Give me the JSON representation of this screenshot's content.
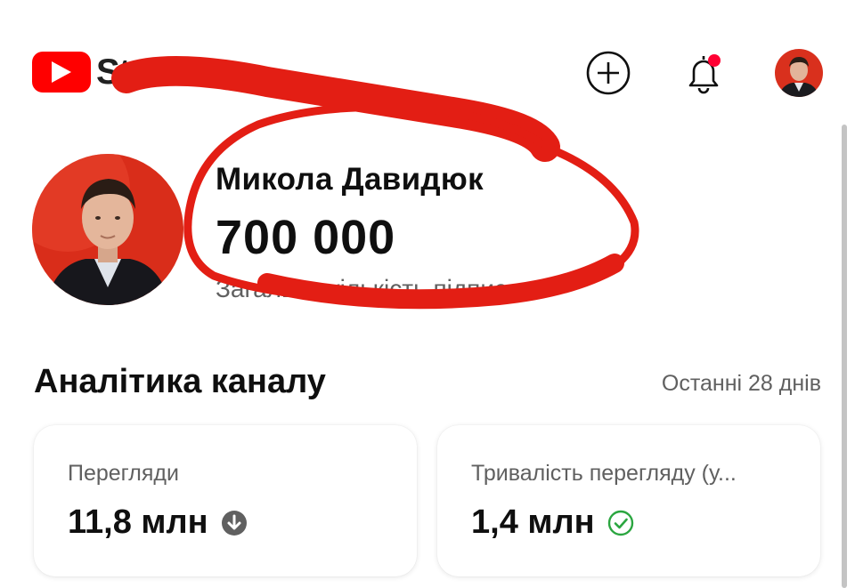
{
  "header": {
    "logo_text": "Studio",
    "logo_icon": "youtube-play-icon",
    "create_icon": "add-circle-icon",
    "notifications_icon": "bell-icon",
    "notification_dot_color": "#ff0033"
  },
  "channel": {
    "name": "Микола Давидюк",
    "subscribers": "700 000",
    "subscribers_label": "Загальна кількість підписок"
  },
  "analytics": {
    "title": "Аналітика каналу",
    "period": "Останні 28 днів",
    "cards": [
      {
        "label": "Перегляди",
        "value": "11,8 млн",
        "status_icon": "arrow-down-circle-icon",
        "status_color": "#606060"
      },
      {
        "label": "Тривалість перегляду (у...",
        "value": "1,4 млн",
        "status_icon": "check-circle-icon",
        "status_color": "#2ba640"
      }
    ]
  },
  "colors": {
    "brand_red": "#ff0000",
    "markup_red": "#e31e14",
    "text_primary": "#0f0f0f",
    "text_secondary": "#606060"
  }
}
